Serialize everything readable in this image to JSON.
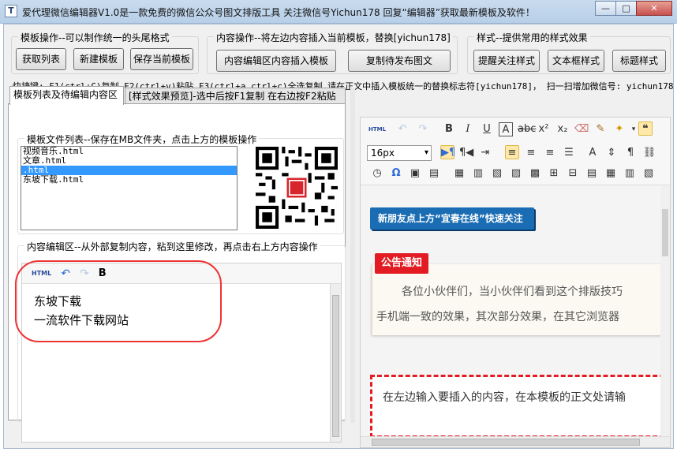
{
  "window": {
    "title": "爱代理微信编辑器V1.0是一款免费的微信公众号图文排版工具 关注微信号Yichun178 回复“编辑器”获取最新模板及软件！",
    "app_icon": "T",
    "minimize": "—",
    "maximize": "□",
    "close": "✕"
  },
  "template_group": {
    "title": "模板操作--可以制作统一的头尾格式",
    "buttons": [
      "获取列表",
      "新建模板",
      "保存当前模板"
    ]
  },
  "content_group": {
    "title": "内容操作--将左边内容插入当前模板，替换[yichun178]",
    "buttons": [
      "内容编辑区内容插入模板",
      "复制待发布图文"
    ]
  },
  "style_group": {
    "title": "样式--提供常用的样式效果",
    "buttons": [
      "提醒关注样式",
      "文本框样式",
      "标题样式"
    ]
  },
  "shortcut_text": "快捷键: F1(ctrl+C)复制  F2(ctrl+v)粘贴 F3(ctrl+a ctrl+c)全选复制     请在正文中插入模板统一的替换标志符[yichun178]，   扫一扫增加微信号: yichun178",
  "tabs": [
    "模板列表及待编辑内容区",
    "[样式效果预览]-选中后按F1复制 在右边按F2粘贴"
  ],
  "file_list": {
    "title": "模板文件列表--保存在MB文件夹，点击上方的模板操作",
    "items": [
      "视频音乐.html",
      "文章.html",
      ".html",
      "东坡下载.html"
    ],
    "selected_index": 2
  },
  "edit_area": {
    "title": "内容编辑区--从外部复制内容，粘到这里修改，再点击右上方内容操作",
    "toolbar": {
      "html": "HTML",
      "bold": "B"
    },
    "lines": [
      "东坡下载",
      "一流软件下载网站"
    ]
  },
  "right_editor": {
    "toolbar": {
      "html": "HTML",
      "font_size": "16px"
    },
    "banner": "新朋友点上方“宜春在线”快速关注",
    "notice_badge": "公告通知",
    "notice_line1": "各位小伙伴们，当小伙伴们看到这个排版技巧",
    "notice_line2": "手机端一致的效果，其次部分效果，在其它浏览器",
    "dashed_text": "在左边输入要插入的内容，在本模板的正文处请输"
  },
  "colors": {
    "accent_blue": "#1a6cb3",
    "notice_red": "#e31c23",
    "selection": "#3399ff"
  }
}
